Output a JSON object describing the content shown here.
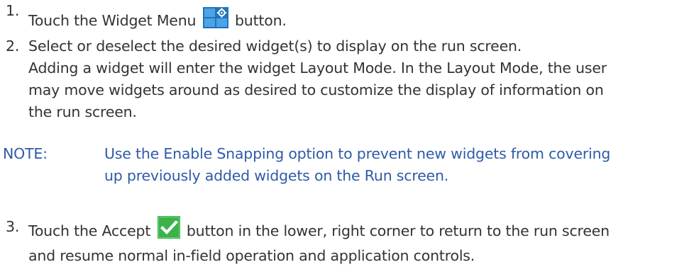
{
  "steps": [
    {
      "number": "1.",
      "before_icon": "Touch the Widget Menu",
      "icon": "widget-menu-icon",
      "after_icon": "button."
    },
    {
      "number": "2.",
      "line1": "Select or deselect the desired widget(s) to display on the run screen.",
      "detail": [
        "Adding a widget will enter the widget Layout Mode. In the Layout Mode, the user",
        "may move widgets around as desired to customize the display of information on",
        "the run screen."
      ]
    },
    {
      "number": "3.",
      "before_icon": "Touch the Accept",
      "icon": "accept-checkmark-icon",
      "after_icon": "button in the lower, right corner to return to the run screen",
      "line2": "and resume normal in-field operation and application controls."
    }
  ],
  "note": {
    "label": "NOTE:",
    "lines": [
      "Use the Enable Snapping option to prevent new widgets from covering",
      "up previously added widgets on the Run screen."
    ]
  },
  "colors": {
    "body_text": "#333333",
    "note_text": "#2f5aa8",
    "widget_icon_blue": "#1f74bb",
    "accept_green": "#3bb34a"
  }
}
